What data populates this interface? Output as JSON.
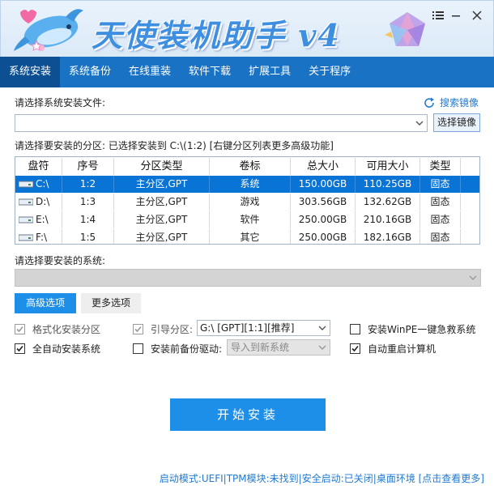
{
  "window": {
    "title": "天使装机助手 v4",
    "buttons": [
      "menu",
      "minimize",
      "close"
    ]
  },
  "nav": {
    "tabs": [
      "系统安装",
      "系统备份",
      "在线重装",
      "软件下载",
      "扩展工具",
      "关于程序"
    ],
    "active_index": 0
  },
  "install_file": {
    "label": "请选择系统安装文件:",
    "value": "",
    "search_label": "搜索镜像",
    "choose_button": "选择镜像"
  },
  "partition": {
    "label": "请选择要安装的分区: 已选择安装到 C:\\(1:2) [右键分区列表更多高级功能]",
    "columns": [
      "盘符",
      "序号",
      "分区类型",
      "卷标",
      "总大小",
      "可用大小",
      "类型"
    ],
    "rows": [
      {
        "drive": "C:\\",
        "index": "1:2",
        "type": "主分区,GPT",
        "label": "系统",
        "total": "150.00GB",
        "free": "110.25GB",
        "kind": "固态",
        "selected": true
      },
      {
        "drive": "D:\\",
        "index": "1:3",
        "type": "主分区,GPT",
        "label": "游戏",
        "total": "303.56GB",
        "free": "132.62GB",
        "kind": "固态",
        "selected": false
      },
      {
        "drive": "E:\\",
        "index": "1:4",
        "type": "主分区,GPT",
        "label": "软件",
        "total": "250.00GB",
        "free": "210.16GB",
        "kind": "固态",
        "selected": false
      },
      {
        "drive": "F:\\",
        "index": "1:5",
        "type": "主分区,GPT",
        "label": "其它",
        "total": "250.00GB",
        "free": "182.16GB",
        "kind": "固态",
        "selected": false
      }
    ]
  },
  "system_select": {
    "label": "请选择要安装的系统:",
    "value": ""
  },
  "options": {
    "tabs": [
      "高级选项",
      "更多选项"
    ],
    "active_index": 0,
    "format_partition": {
      "label": "格式化安装分区",
      "checked": true,
      "disabled": true
    },
    "boot_partition": {
      "label": "引导分区:",
      "checked": true,
      "disabled": true,
      "value": "G:\\ [GPT][1:1][推荐]"
    },
    "install_winpe": {
      "label": "安装WinPE一键急救系统",
      "checked": false
    },
    "auto_install": {
      "label": "全自动安装系统",
      "checked": true
    },
    "backup_drivers": {
      "label": "安装前备份驱动:",
      "checked": false,
      "value": "导入到新系统"
    },
    "auto_restart": {
      "label": "自动重启计算机",
      "checked": true
    }
  },
  "start_button": "开始安装",
  "status": {
    "text": "启动模式:UEFI|TPM模块:未找到|安全启动:已关闭|桌面环境 [点击查看更多]"
  },
  "colors": {
    "nav_bg": "#1a72c4",
    "nav_active": "#0d4f93",
    "selected_row": "#0a74d6",
    "start_button": "#1e8fe8",
    "status_text": "#1f7ad1"
  }
}
